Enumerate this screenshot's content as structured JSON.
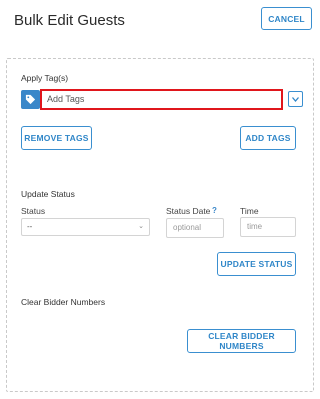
{
  "header": {
    "title": "Bulk Edit Guests",
    "cancel_label": "CANCEL"
  },
  "tags": {
    "section_label": "Apply Tag(s)",
    "input_placeholder": "Add Tags",
    "remove_label": "REMOVE TAGS",
    "add_label": "ADD TAGS"
  },
  "status": {
    "section_label": "Update Status",
    "status_label": "Status",
    "status_value": "--",
    "status_date_label": "Status Date",
    "help_glyph": "?",
    "status_date_placeholder": "optional",
    "time_label": "Time",
    "time_placeholder": "time",
    "update_label": "UPDATE STATUS"
  },
  "bidder": {
    "section_label": "Clear Bidder Numbers",
    "clear_label": "CLEAR BIDDER NUMBERS"
  },
  "colors": {
    "accent": "#2f86c8",
    "highlight_border": "#e0161c"
  }
}
